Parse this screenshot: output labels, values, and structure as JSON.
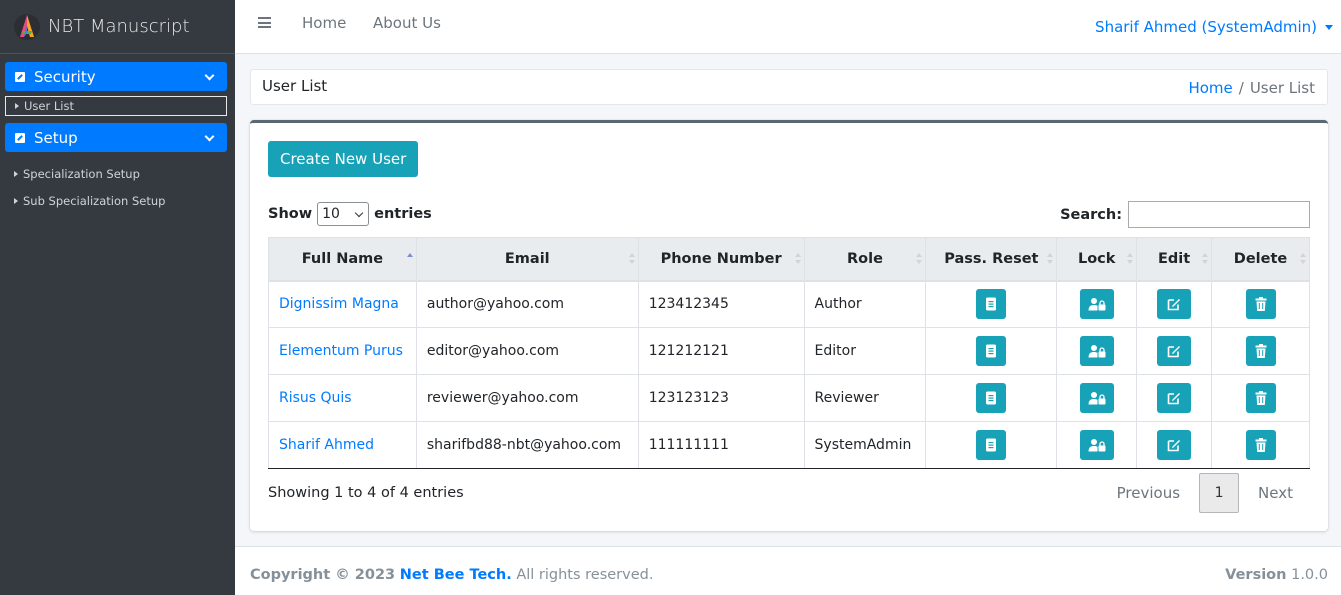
{
  "app": {
    "brand": "NBT Manuscript"
  },
  "sidebar": {
    "groups": [
      {
        "label": "Security",
        "items": [
          "User List"
        ]
      },
      {
        "label": "Setup",
        "items": [
          "Specialization Setup",
          "Sub Specialization Setup"
        ]
      }
    ]
  },
  "topbar": {
    "links": [
      "Home",
      "About Us"
    ],
    "user": "Sharif Ahmed (SystemAdmin)"
  },
  "page": {
    "title": "User List",
    "breadcrumb": {
      "home": "Home",
      "separator": "/",
      "current": "User List"
    }
  },
  "toolbar": {
    "create_label": "Create New User",
    "show_label": "Show",
    "entries_value": "10",
    "entries_label": "entries",
    "search_label": "Search:",
    "search_value": ""
  },
  "table": {
    "columns": [
      "Full Name",
      "Email",
      "Phone Number",
      "Role",
      "Pass. Reset",
      "Lock",
      "Edit",
      "Delete"
    ],
    "sorted_column": "Full Name",
    "sort_direction": "ascending",
    "rows": [
      {
        "name": "Dignissim Magna",
        "email": "author@yahoo.com",
        "phone": "123412345",
        "role": "Author"
      },
      {
        "name": "Elementum Purus",
        "email": "editor@yahoo.com",
        "phone": "121212121",
        "role": "Editor"
      },
      {
        "name": "Risus Quis",
        "email": "reviewer@yahoo.com",
        "phone": "123123123",
        "role": "Reviewer"
      },
      {
        "name": "Sharif Ahmed",
        "email": "sharifbd88-nbt@yahoo.com",
        "phone": "111111111",
        "role": "SystemAdmin"
      }
    ]
  },
  "pagination": {
    "info": "Showing 1 to 4 of 4 entries",
    "previous": "Previous",
    "current": "1",
    "next": "Next"
  },
  "footer": {
    "copyright_prefix": "Copyright © 2023",
    "company": "Net Bee Tech.",
    "rights": "All rights reserved.",
    "version_label": "Version",
    "version": "1.0.0"
  },
  "colors": {
    "primary": "#007bff",
    "info": "#17a2b8",
    "sidebar": "#343a40"
  },
  "icons": {
    "pass_reset": "file-icon",
    "lock": "user-lock-icon",
    "edit": "edit-icon",
    "delete": "trash-icon"
  }
}
